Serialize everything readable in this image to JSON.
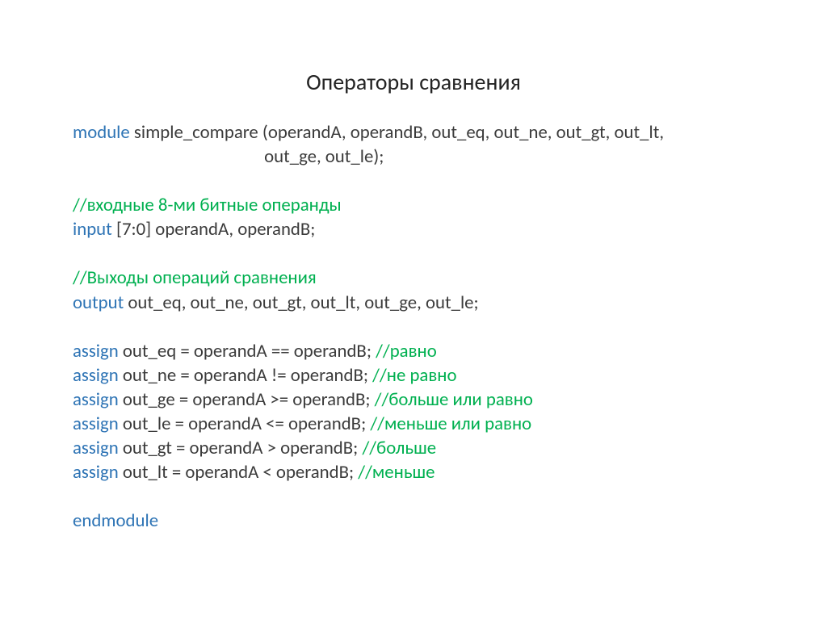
{
  "title": "Операторы сравнения",
  "code": {
    "keywords": {
      "module": "module",
      "input": "input",
      "output": "output",
      "assign": "assign",
      "endmodule": "endmodule"
    },
    "decl1": " simple_compare (operandA, operandB, out_eq, out_ne, out_gt, out_lt,",
    "decl2": "                                              out_ge, out_le);",
    "blank": "",
    "comment_inputs": "//входные 8-ми битные операнды",
    "input_decl": " [7:0] operandA, operandB;",
    "comment_outputs": "//Выходы операций сравнения",
    "output_decl": " out_eq, out_ne, out_gt, out_lt, out_ge, out_le;",
    "a_eq": " out_eq = operandA == operandB; ",
    "c_eq": "//равно",
    "a_ne": " out_ne = operandA != operandB; ",
    "c_ne": "//не равно",
    "a_ge": " out_ge = operandA >= operandB; ",
    "c_ge": "//больше или равно",
    "a_le": " out_le = operandA <= operandB; ",
    "c_le": "//меньше или равно",
    "a_gt": " out_gt = operandA > operandB; ",
    "c_gt": "//больше",
    "a_lt": " out_lt = operandA < operandB; ",
    "c_lt": "//меньше"
  }
}
